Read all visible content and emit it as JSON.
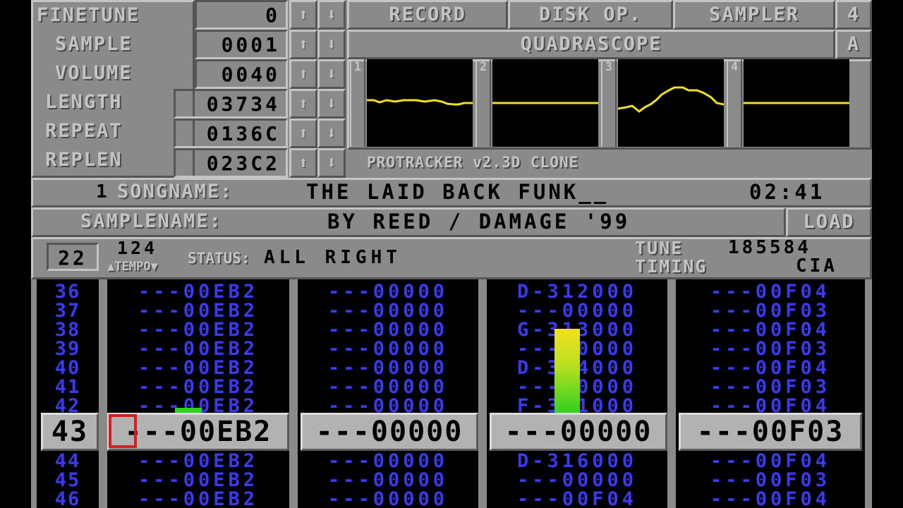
{
  "params": {
    "finetune": {
      "label": "FINETUNE",
      "value": "0"
    },
    "sample": {
      "label": "SAMPLE",
      "value": "0001"
    },
    "volume": {
      "label": "VOLUME",
      "value": "0040"
    },
    "length": {
      "label": "LENGTH",
      "value": "03734"
    },
    "repeat": {
      "label": "REPEAT",
      "value": "0136C"
    },
    "replen": {
      "label": "REPLEN",
      "value": "023C2"
    }
  },
  "arrows": {
    "up": "⬆",
    "down": "⬇"
  },
  "toolbar": {
    "record": "RECORD",
    "disk_op": "DISK OP.",
    "sampler": "SAMPLER",
    "four": "4"
  },
  "scope": {
    "title": "QUADRASCOPE",
    "a_button": "A",
    "channels": [
      "1",
      "2",
      "3",
      "4"
    ],
    "version": "PROTRACKER v2.3D CLONE",
    "wave_color": "#f0e020"
  },
  "song": {
    "number": "1",
    "label": "SONGNAME:",
    "name": "THE LAID BACK FUNK__",
    "time": "02:41"
  },
  "samplename": {
    "label": "SAMPLENAME:",
    "name": "BY REED / DAMAGE '99",
    "load": "LOAD"
  },
  "status": {
    "pos": "22",
    "tempo_value": "124",
    "tempo_label": "TEMPO",
    "status_label": "STATUS:",
    "status_text": "ALL RIGHT",
    "tune_label": "TUNE",
    "tune_value": "185584",
    "timing_label": "TIMING",
    "timing_value": "CIA"
  },
  "colors": {
    "pattern_text": "#3a3af0",
    "cursor_box": "#d02020",
    "vu_bottom": "#30d020",
    "vu_top": "#f0e020"
  },
  "pattern": {
    "rows_above": [
      "36",
      "37",
      "38",
      "39",
      "40",
      "41",
      "42"
    ],
    "current_row": "43",
    "rows_below": [
      "44",
      "45",
      "46"
    ],
    "channels": [
      {
        "above": [
          "---00EB2",
          "---00EB2",
          "---00EB2",
          "---00EB2",
          "---00EB2",
          "---00EB2",
          "---00EB2"
        ],
        "current": "---00EB2",
        "below": [
          "---00EB2",
          "---00EB2",
          "---00EB2"
        ]
      },
      {
        "above": [
          "---00000",
          "---00000",
          "---00000",
          "---00000",
          "---00000",
          "---00000",
          "---00000"
        ],
        "current": "---00000",
        "below": [
          "---00000",
          "---00000",
          "---00000"
        ]
      },
      {
        "above": [
          "D-312000",
          "---00000",
          "G-313000",
          "---00000",
          "D-314000",
          "---00000",
          "F-311000"
        ],
        "current": "---00000",
        "below": [
          "D-316000",
          "---00000",
          "---00F04"
        ]
      },
      {
        "above": [
          "---00F04",
          "---00F03",
          "---00F04",
          "---00F03",
          "---00F04",
          "---00F03",
          "---00F04"
        ],
        "current": "---00F03",
        "below": [
          "---00F04",
          "---00F03",
          "---00F04"
        ]
      }
    ]
  }
}
